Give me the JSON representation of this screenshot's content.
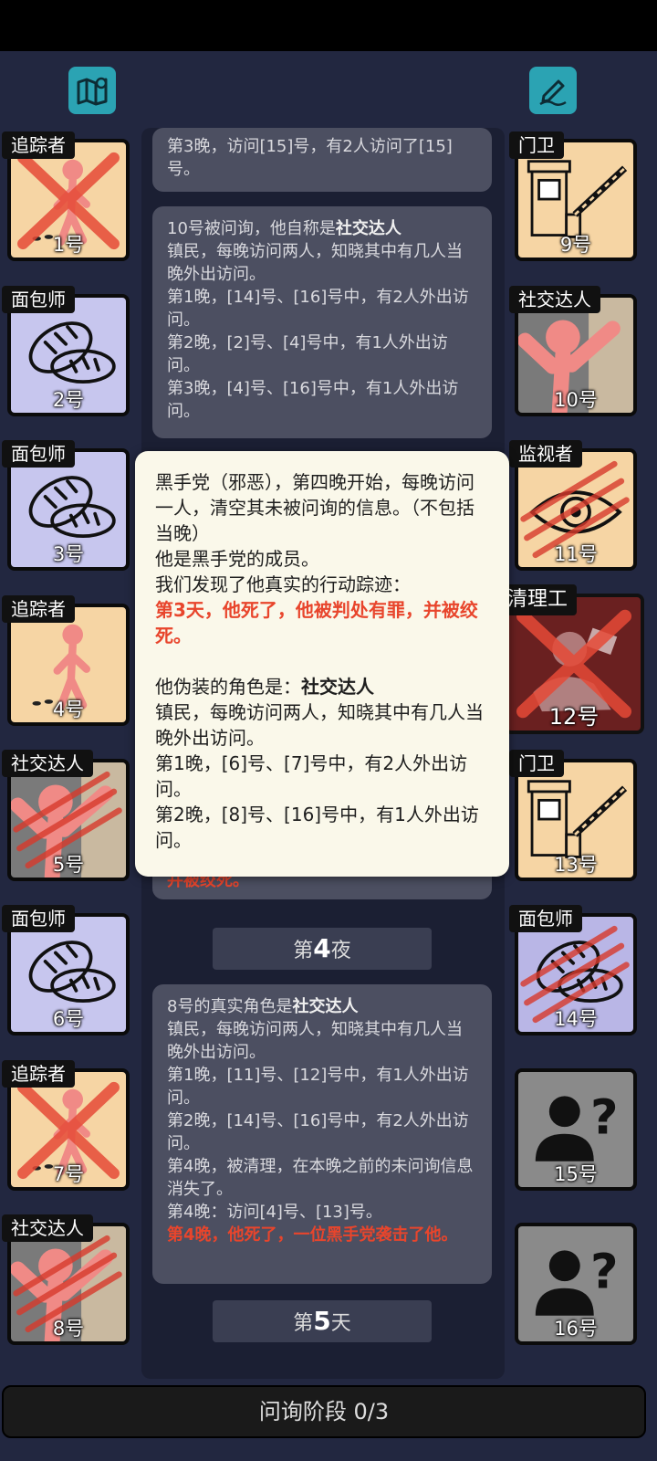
{
  "players": [
    {
      "num": "1号",
      "role": "追踪者"
    },
    {
      "num": "2号",
      "role": "面包师"
    },
    {
      "num": "3号",
      "role": "面包师"
    },
    {
      "num": "4号",
      "role": "追踪者"
    },
    {
      "num": "5号",
      "role": "社交达人"
    },
    {
      "num": "6号",
      "role": "面包师"
    },
    {
      "num": "7号",
      "role": "追踪者"
    },
    {
      "num": "8号",
      "role": "社交达人"
    },
    {
      "num": "9号",
      "role": "门卫"
    },
    {
      "num": "10号",
      "role": "社交达人"
    },
    {
      "num": "11号",
      "role": "监视者"
    },
    {
      "num": "12号",
      "role": "清理工"
    },
    {
      "num": "13号",
      "role": "门卫"
    },
    {
      "num": "14号",
      "role": "面包师"
    },
    {
      "num": "15号",
      "role": ""
    },
    {
      "num": "16号",
      "role": ""
    }
  ],
  "log": {
    "msg_top": "第3晚，访问[15]号，有2人访问了[15]号。",
    "msg10": {
      "intro": "10号被问询，他自称是",
      "role": "社交达人",
      "l1": "镇民，每晚访问两人，知晓其中有几人当晚外出访问。",
      "l2": "第1晚，[14]号、[16]号中，有2人外出访问。",
      "l3": "第2晚，[2]号、[4]号中，有1人外出访问。",
      "l4": "第3晚，[4]号、[16]号中，有1人外出访问。"
    },
    "peek": "并被绞死。",
    "night4": {
      "pre": "第",
      "n": "4",
      "post": "夜"
    },
    "msg8": {
      "intro": "8号的真实角色是",
      "role": "社交达人",
      "l1": "镇民，每晚访问两人，知晓其中有几人当晚外出访问。",
      "l2": "第1晚，[11]号、[12]号中，有1人外出访问。",
      "l3": "第2晚，[14]号、[16]号中，有2人外出访问。",
      "l4": "第4晚，被清理，在本晚之前的未问询信息消失了。",
      "l5": "第4晚：访问[4]号、[13]号。",
      "death": "第4晚，他死了，一位黑手党袭击了他。"
    },
    "day5": {
      "pre": "第",
      "n": "5",
      "post": "天"
    }
  },
  "popup": {
    "l1": "黑手党（邪恶），第四晚开始，每晚访问一人，清空其未被问询的信息。（不包括当晚）",
    "l2": "他是黑手党的成员。",
    "l3": "我们发现了他真实的行动踪迹：",
    "death": "第3天，他死了，他被判处有罪，并被绞死。",
    "disguise_intro": "他伪装的角色是：",
    "disguise_role": "社交达人",
    "l4": "镇民，每晚访问两人，知晓其中有几人当晚外出访问。",
    "l5": "第1晚，[6]号、[7]号中，有2人外出访问。",
    "l6": "第2晚，[8]号、[16]号中，有1人外出访问。"
  },
  "bottom": {
    "label": "问询阶段 0/3"
  },
  "colors": {
    "panel": "#222740",
    "popup": "#faf8ea",
    "alert": "#e8452c",
    "icon": "#2ba3b3"
  }
}
